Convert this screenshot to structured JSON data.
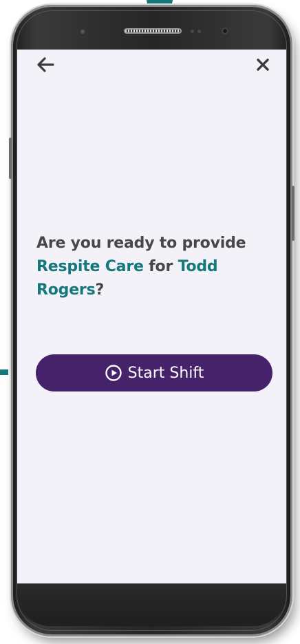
{
  "screen": {
    "background_color": "#f3f2f8"
  },
  "nav": {
    "back_icon": "arrow-left-icon",
    "close_icon": "close-icon"
  },
  "prompt": {
    "part1": "Are you ready to provide ",
    "service": "Respite Care",
    "part2": " for ",
    "client": "Todd Rogers",
    "part3": "?"
  },
  "start_button": {
    "label": "Start Shift",
    "icon": "play-circle-icon",
    "color": "#46226a"
  },
  "colors": {
    "accent": "#15787a",
    "text": "#474747"
  }
}
